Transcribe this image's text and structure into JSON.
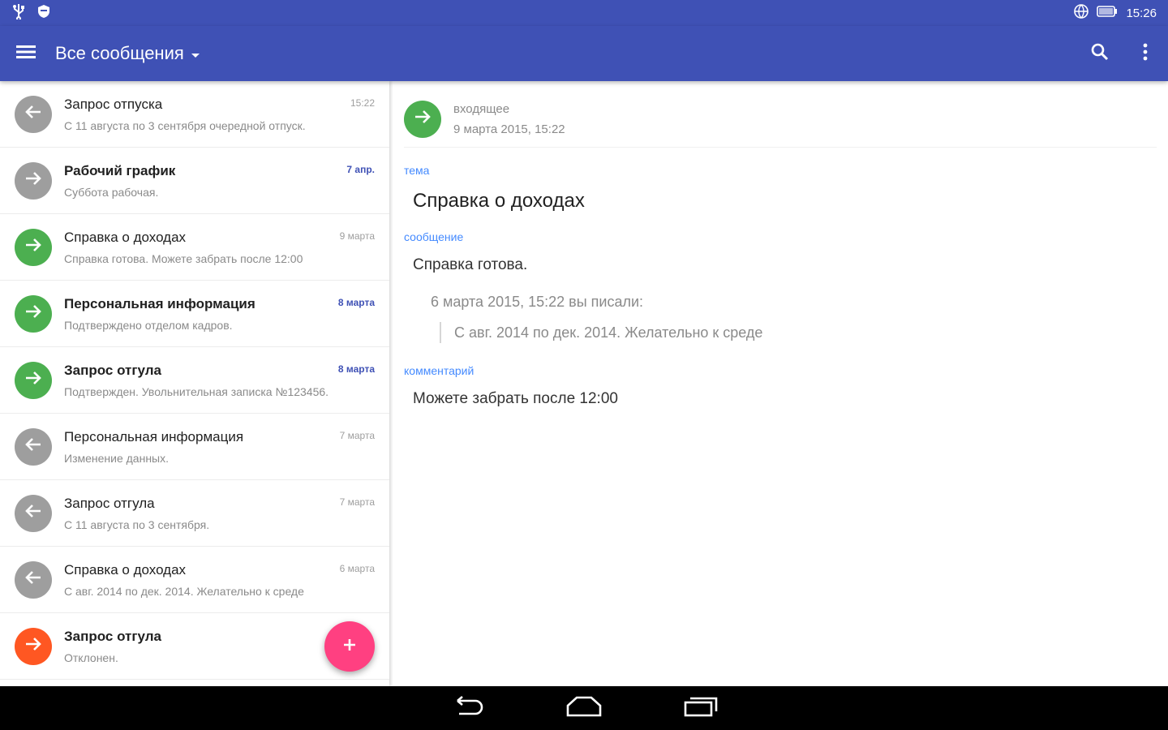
{
  "status_bar": {
    "time": "15:26",
    "icons": [
      "usb-icon",
      "shield-icon",
      "globe-icon",
      "battery-icon"
    ]
  },
  "app_bar": {
    "title": "Все сообщения",
    "icons": [
      "menu-icon",
      "dropdown-arrow-icon",
      "search-icon",
      "more-vert-icon"
    ]
  },
  "colors": {
    "primary": "#3f51b5",
    "accent": "#ff4081",
    "incoming": "#4caf50",
    "outgoing": "#9e9e9e",
    "rejected": "#ff5722",
    "label": "#448aff"
  },
  "messages": [
    {
      "title": "Запрос отпуска",
      "snippet": "С 11 августа по 3 сентября очередной отпуск.",
      "date": "15:22",
      "direction": "out",
      "unread": false
    },
    {
      "title": "Рабочий график",
      "snippet": "Суббота рабочая.",
      "date": "7 апр.",
      "direction": "in-gray",
      "unread": true
    },
    {
      "title": "Справка о доходах",
      "snippet": "Справка готова. Можете забрать после 12:00",
      "date": "9 марта",
      "direction": "in",
      "unread": false
    },
    {
      "title": "Персональная информация",
      "snippet": "Подтверждено отделом кадров.",
      "date": "8 марта",
      "direction": "in",
      "unread": true
    },
    {
      "title": "Запрос отгула",
      "snippet": "Подтвержден. Увольнительная записка №123456.",
      "date": "8 марта",
      "direction": "in",
      "unread": true
    },
    {
      "title": "Персональная информация",
      "snippet": "Изменение данных.",
      "date": "7 марта",
      "direction": "out",
      "unread": false
    },
    {
      "title": "Запрос отгула",
      "snippet": "С 11 августа по 3 сентября.",
      "date": "7 марта",
      "direction": "out",
      "unread": false
    },
    {
      "title": "Справка о доходах",
      "snippet": "С авг. 2014 по дек. 2014. Желательно к среде",
      "date": "6 марта",
      "direction": "out",
      "unread": false
    },
    {
      "title": "Запрос отгула",
      "snippet": "Отклонен.",
      "date": "",
      "direction": "rejected",
      "unread": true
    }
  ],
  "fab": {
    "label": "+",
    "icon": "add-icon"
  },
  "detail": {
    "folder": "входящее",
    "date": "9 марта 2015, 15:22",
    "subject_label": "тема",
    "subject": "Справка о доходах",
    "message_label": "сообщение",
    "message": "Справка готова.",
    "quote_header": "6 марта 2015, 15:22 вы писали:",
    "quote": "С авг. 2014 по дек. 2014. Желательно к среде",
    "comment_label": "комментарий",
    "comment": "Можете забрать после 12:00"
  },
  "nav_bar": {
    "icons": [
      "back-icon",
      "home-icon",
      "recents-icon"
    ]
  }
}
